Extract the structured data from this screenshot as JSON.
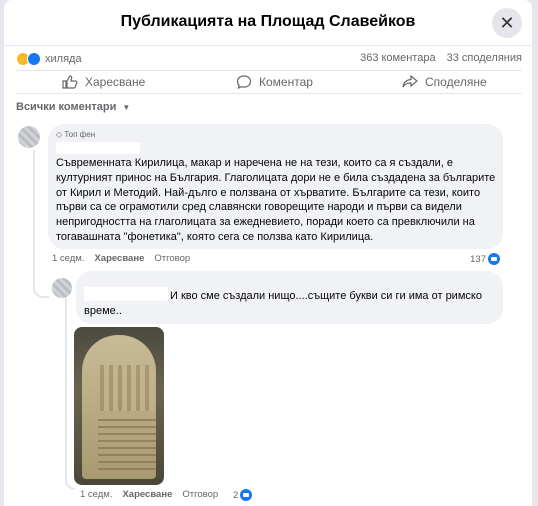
{
  "header": {
    "title": "Публикацията на Площад Славейков",
    "close_icon": "close-icon"
  },
  "stats": {
    "reactions_label": "хиляда",
    "comments": "363 коментара",
    "shares": "33 споделяния"
  },
  "actions": {
    "like": "Харесване",
    "comment": "Коментар",
    "share": "Споделяне"
  },
  "filter": {
    "label": "Всички коментари"
  },
  "comment1": {
    "badge": "Топ фен",
    "text": "Съвременната Кирилица, макар и наречена не на тези, които са я създали, е културният принос на България. Глаголицата дори не е била създадена за българите от Кирил и Методий. Най-дълго е ползвана от хърватите. Българите са тези, които първи са се ограмотили сред славянски говорещите народи и първи са видели непригодността на глаголицата за ежедневието, поради което са превключили на тогавашната \"фонетика\", която сега се ползва като Кирилица.",
    "time": "1 седм.",
    "like": "Харесване",
    "reply": "Отговор",
    "likes_count": "137"
  },
  "comment2": {
    "text": "И кво сме създали нищо....същите букви си ги има от римско време..",
    "time": "1 седм.",
    "like": "Харесване",
    "reply": "Отговор",
    "likes_count": "2"
  },
  "colors": {
    "accent": "#1877f2",
    "bubble": "#f0f2f5",
    "secondary_text": "#65676b"
  }
}
